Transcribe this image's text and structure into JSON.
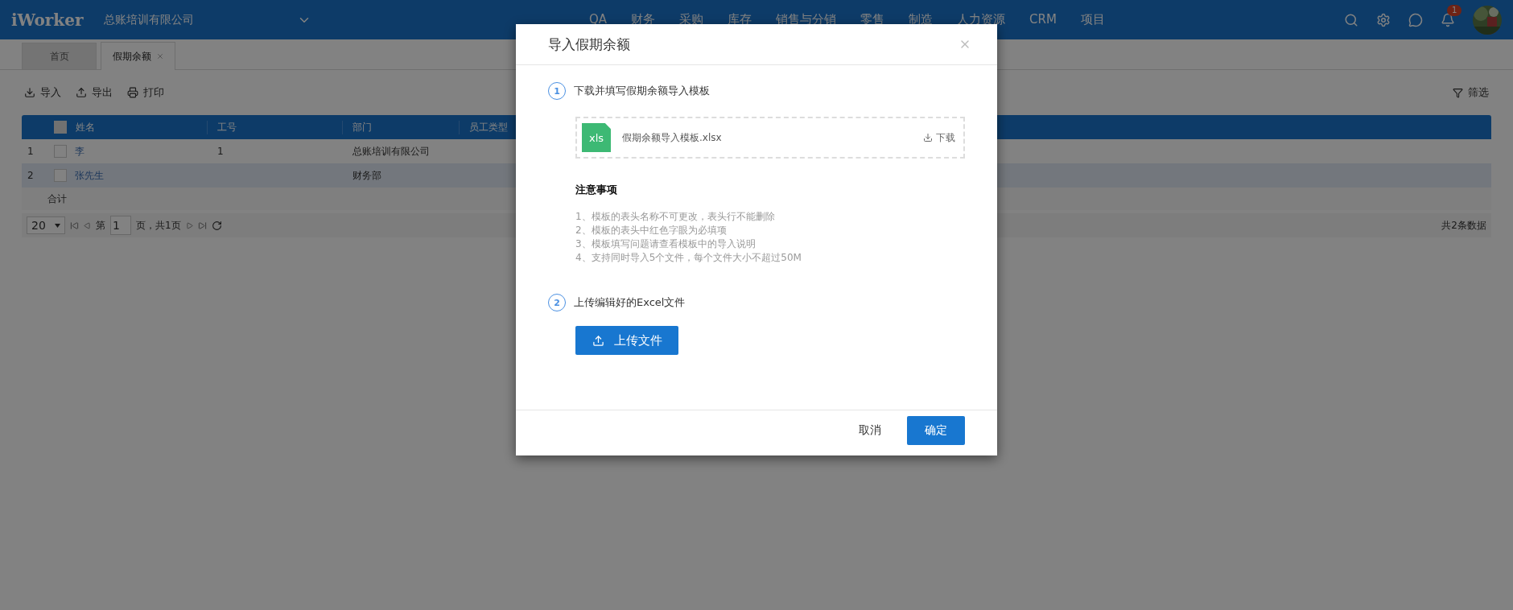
{
  "app": {
    "logo": "iWorker",
    "company": "总账培训有限公司",
    "nav": [
      "QA",
      "财务",
      "采购",
      "库存",
      "销售与分销",
      "零售",
      "制造",
      "人力资源",
      "CRM",
      "项目"
    ],
    "notification_count": "1"
  },
  "tabs": [
    {
      "label": "首页",
      "selected": false,
      "closable": false
    },
    {
      "label": "假期余额",
      "selected": true,
      "closable": true
    }
  ],
  "toolbar": {
    "actions": [
      {
        "kind": "import",
        "label": "导入"
      },
      {
        "kind": "export",
        "label": "导出"
      },
      {
        "kind": "print",
        "label": "打印"
      }
    ],
    "filter": "筛选"
  },
  "table": {
    "columns": [
      "姓名",
      "工号",
      "部门",
      "员工类型"
    ],
    "select_all_checked": false,
    "rows": [
      {
        "index": "1",
        "checked": false,
        "hovered": false,
        "name": "李",
        "id": "1",
        "department": "总账培训有限公司"
      },
      {
        "index": "2",
        "checked": false,
        "hovered": true,
        "name": "张先生",
        "department": "财务部"
      }
    ],
    "total_label": "合计"
  },
  "pager": {
    "page_size": "20",
    "page_prefix": "第",
    "page": "1",
    "page_suffix": "页，共1页",
    "summary": "共2条数据"
  },
  "dialog": {
    "title": "导入假期余额",
    "steps": [
      {
        "number": "1",
        "title": "下载并填写假期余额导入模板"
      },
      {
        "number": "2",
        "title": "上传编辑好的Excel文件"
      }
    ],
    "file": {
      "type_label": "xls",
      "name": "假期余额导入模板.xlsx",
      "download": "下载"
    },
    "notes_title": "注意事项",
    "notes": [
      "1、模板的表头名称不可更改，表头行不能删除",
      "2、模板的表头中红色字眼为必填项",
      "3、模板填写问题请查看模板中的导入说明",
      "4、支持同时导入5个文件，每个文件大小不超过50M"
    ],
    "upload_button": "上传文件",
    "cancel": "取消",
    "confirm": "确定"
  }
}
